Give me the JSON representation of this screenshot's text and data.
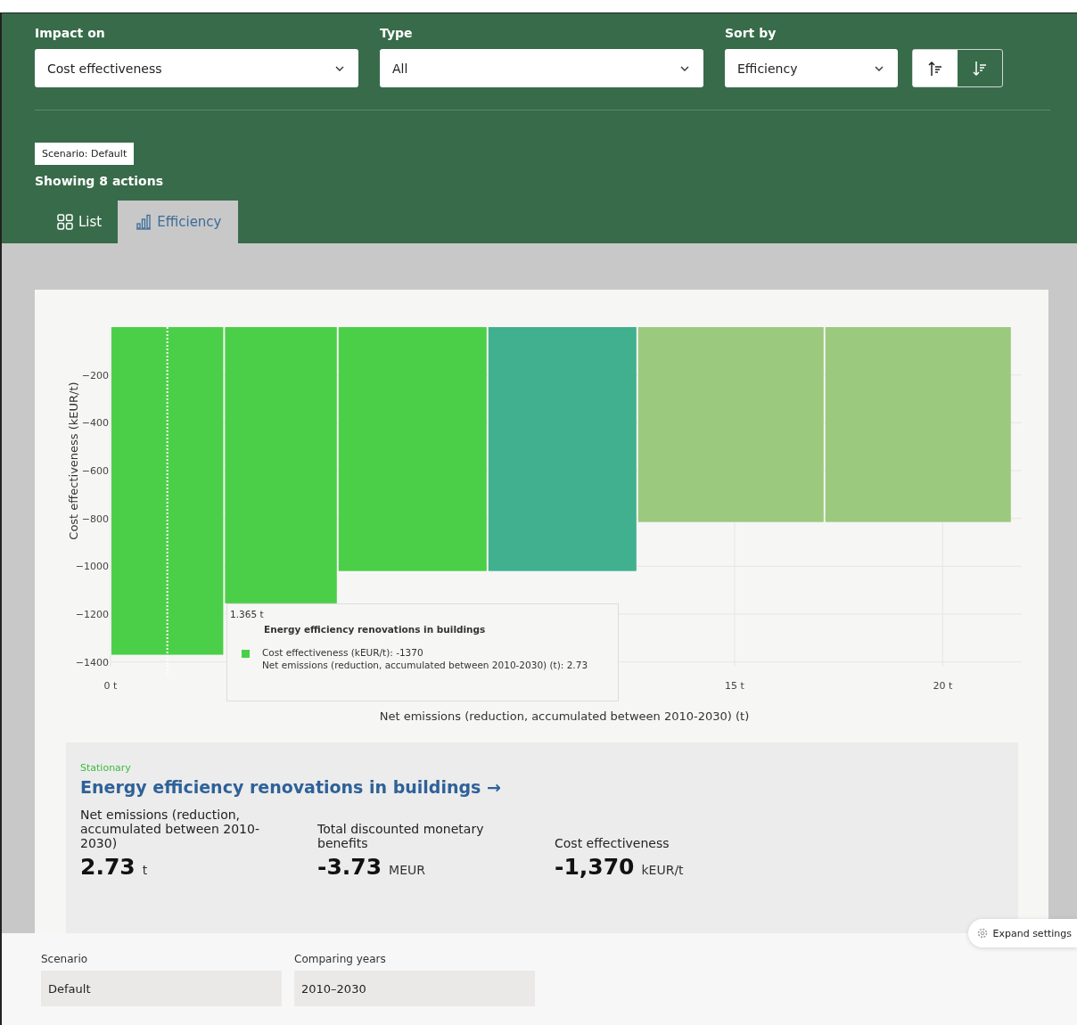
{
  "filters": [
    {
      "label": "Impact on",
      "value": "Cost effectiveness"
    },
    {
      "label": "Type",
      "value": "All"
    },
    {
      "label": "Sort by",
      "value": "Efficiency"
    }
  ],
  "sort_buttons": [
    {
      "selected": true
    },
    {
      "selected": false
    }
  ],
  "scenario_tag": "Scenario: Default",
  "result_count": "Showing 8 actions",
  "tabs": [
    {
      "label": "List",
      "selected": false
    },
    {
      "label": "Efficiency",
      "selected": true
    }
  ],
  "chart": {
    "chart_data": {
      "type": "bar",
      "xlabel": "Net emissions (reduction, accumulated between 2010-2030) (t)",
      "ylabel": "Cost effectiveness (kEUR/t)",
      "x": [
        1.365,
        4.095,
        7.26,
        10.86,
        14.91,
        19.41
      ],
      "series": [
        {
          "color": "#4ccf48",
          "values": [
            -1370,
            -1155,
            -1020,
            null,
            null,
            null
          ]
        },
        {
          "color": "#40b08e",
          "values": [
            null,
            null,
            null,
            -1020,
            null,
            null
          ]
        },
        {
          "color": "#9bc97e",
          "values": [
            null,
            null,
            null,
            null,
            -815,
            -815
          ]
        }
      ],
      "xlim": [
        0,
        21.9
      ],
      "ylim": [
        -1420,
        0
      ],
      "grid": true,
      "xticks": [
        {
          "value": 0,
          "label": "0 t"
        },
        {
          "value": 15,
          "label": "15 t"
        },
        {
          "value": 20,
          "label": "20 t"
        }
      ],
      "yticks": [
        {
          "value": -200,
          "label": "−200"
        },
        {
          "value": -400,
          "label": "−400"
        },
        {
          "value": -600,
          "label": "−600"
        },
        {
          "value": -800,
          "label": "−800"
        },
        {
          "value": -1000,
          "label": "−1000"
        },
        {
          "value": -1200,
          "label": "−1200"
        },
        {
          "value": -1400,
          "label": "−1400"
        }
      ],
      "ref_lines": [
        {
          "axis": "x",
          "value": 1.365
        }
      ]
    },
    "tooltip": {
      "x_value": "1.365 t",
      "title": "Energy efficiency renovations in buildings",
      "color": "#4ccf48",
      "lines": [
        "Cost effectiveness (kEUR/t): -1370",
        "Net emissions (reduction, accumulated between 2010-2030) (t): 2.73"
      ]
    }
  },
  "detail": {
    "category": "Stationary",
    "title": "Energy efficiency renovations in buildings",
    "arrow": "→",
    "metrics": [
      {
        "label": "Net emissions (reduction, accumulated between 2010-2030)",
        "value": "2.73",
        "unit": "t"
      },
      {
        "label": "Total discounted monetary benefits",
        "value": "-3.73",
        "unit": "MEUR"
      },
      {
        "label": "Cost effectiveness",
        "value": "-1,370",
        "unit": "kEUR/t"
      }
    ]
  },
  "settings": {
    "fields": [
      {
        "label": "Scenario",
        "value": "Default"
      },
      {
        "label": "Comparing years",
        "value": "2010–2030"
      }
    ],
    "expand_button": "Expand settings"
  }
}
